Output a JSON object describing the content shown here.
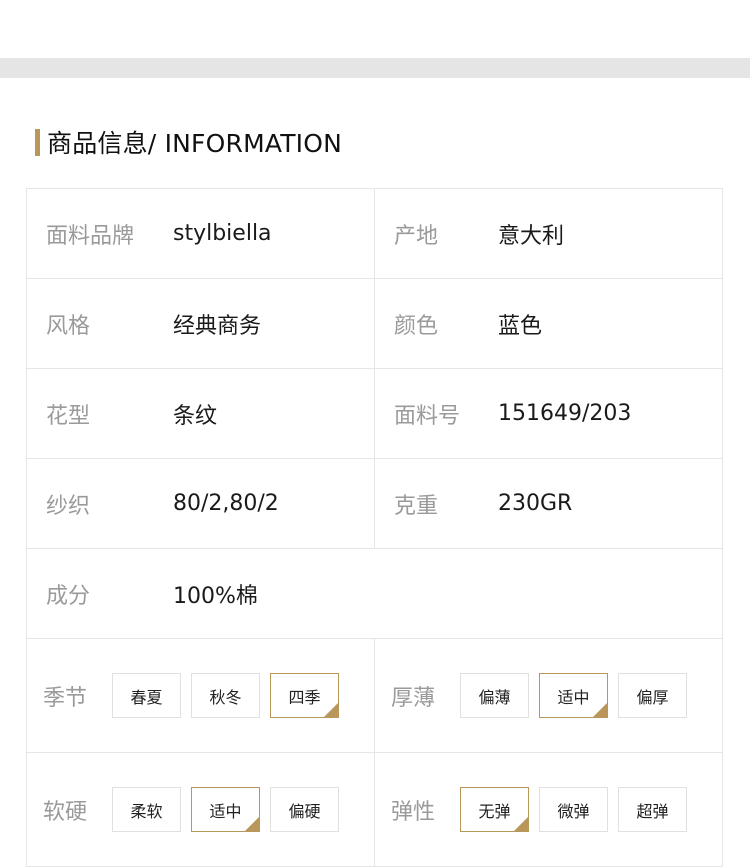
{
  "heading": {
    "title": "商品信息/ INFORMATION"
  },
  "colors": {
    "accent": "#b9975b",
    "label": "#9a9a9a",
    "border": "#e6e6e6"
  },
  "specs": {
    "fabric_brand": {
      "label": "面料品牌",
      "value": "stylbiella"
    },
    "origin": {
      "label": "产地",
      "value": "意大利"
    },
    "style": {
      "label": "风格",
      "value": "经典商务"
    },
    "color": {
      "label": "颜色",
      "value": "蓝色"
    },
    "pattern": {
      "label": "花型",
      "value": "条纹"
    },
    "fabric_no": {
      "label": "面料号",
      "value": "151649/203"
    },
    "yarn": {
      "label": "纱织",
      "value": "80/2,80/2"
    },
    "weight": {
      "label": "克重",
      "value": "230GR"
    },
    "composition": {
      "label": "成分",
      "value": "100%棉"
    }
  },
  "options": {
    "season": {
      "label": "季节",
      "choices": [
        "春夏",
        "秋冬",
        "四季"
      ],
      "selected": "四季"
    },
    "thickness": {
      "label": "厚薄",
      "choices": [
        "偏薄",
        "适中",
        "偏厚"
      ],
      "selected": "适中"
    },
    "softness": {
      "label": "软硬",
      "choices": [
        "柔软",
        "适中",
        "偏硬"
      ],
      "selected": "适中"
    },
    "elasticity": {
      "label": "弹性",
      "choices": [
        "无弹",
        "微弹",
        "超弹"
      ],
      "selected": "无弹"
    }
  }
}
